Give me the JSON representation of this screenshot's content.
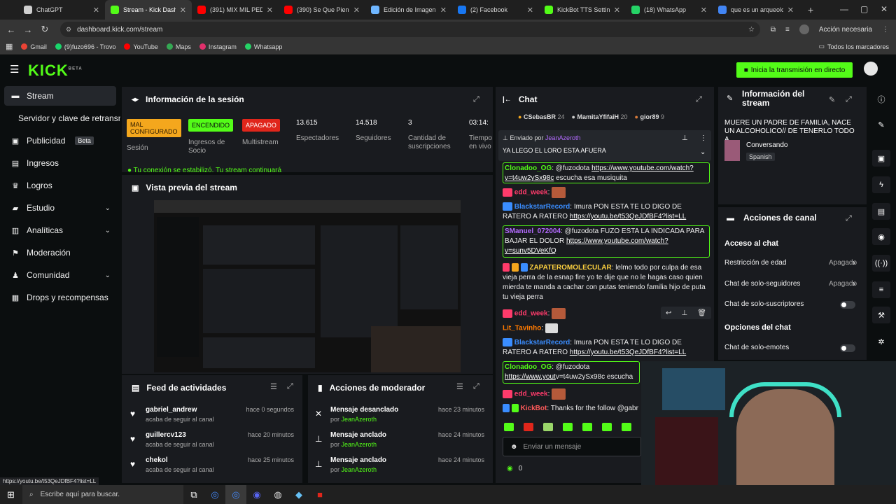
{
  "browser": {
    "tabs": [
      {
        "label": "ChatGPT",
        "color": "#cfcfcf"
      },
      {
        "label": "Stream - Kick Dashb",
        "color": "#53fc18"
      },
      {
        "label": "(391) MIX MIL PEDAZ",
        "color": "#ff0000"
      },
      {
        "label": "(390) Se Que Piensas",
        "color": "#ff0000"
      },
      {
        "label": "Edición de Imagen D",
        "color": "#6fb6ff"
      },
      {
        "label": "(2) Facebook",
        "color": "#1877f2"
      },
      {
        "label": "KickBot TTS Settings",
        "color": "#53fc18"
      },
      {
        "label": "(18) WhatsApp",
        "color": "#25d366"
      },
      {
        "label": "que es un arqueolog",
        "color": "#4285f4"
      }
    ],
    "url": "dashboard.kick.com/stream",
    "profile_label": "Acción necesaria",
    "bookmarks": [
      {
        "label": "Gmail",
        "color": "#ea4335"
      },
      {
        "label": "(9)fuzo696 - Trovo",
        "color": "#19d66b"
      },
      {
        "label": "YouTube",
        "color": "#ff0000"
      },
      {
        "label": "Maps",
        "color": "#34a853"
      },
      {
        "label": "Instagram",
        "color": "#e1306c"
      },
      {
        "label": "Whatsapp",
        "color": "#25d366"
      }
    ],
    "bookmarks_right": "Todos los marcadores"
  },
  "header": {
    "logo": "KICK",
    "logo_sup": "BETA",
    "go_live": "Inicia la transmisión en directo",
    "accent": "#53fc18"
  },
  "sidebar": {
    "items": [
      {
        "label": "Stream"
      },
      {
        "label": "Servidor y clave de retransmisión"
      },
      {
        "label": "Publicidad",
        "badge": "Beta"
      },
      {
        "label": "Ingresos"
      },
      {
        "label": "Logros"
      },
      {
        "label": "Estudio"
      },
      {
        "label": "Analíticas"
      },
      {
        "label": "Moderación"
      },
      {
        "label": "Comunidad"
      },
      {
        "label": "Drops y recompensas"
      }
    ]
  },
  "session": {
    "title": "Información de la sesión",
    "stats": [
      {
        "value": "MAL CONFIGURADO",
        "label": "Sesión"
      },
      {
        "value": "ENCENDIDO",
        "label": "Ingresos de Socio"
      },
      {
        "value": "APAGADO",
        "label": "Multistream"
      },
      {
        "value": "13.615",
        "label": "Espectadores"
      },
      {
        "value": "14.518",
        "label": "Seguidores"
      },
      {
        "value": "3",
        "label": "Cantidad de suscripciones"
      },
      {
        "value": "03:14:",
        "label": "Tiempo en vivo"
      }
    ],
    "notice": "Tu conexión se estabilizó. Tu stream continuará"
  },
  "preview": {
    "title": "Vista previa del stream"
  },
  "feed": {
    "title": "Feed de actividades",
    "items": [
      {
        "user": "gabriel_andrew",
        "sub": "acaba de seguir al canal",
        "time": "hace 0 segundos"
      },
      {
        "user": "guillercv123",
        "sub": "acaba de seguir al canal",
        "time": "hace 20 minutos"
      },
      {
        "user": "chekol",
        "sub": "acaba de seguir al canal",
        "time": "hace 25 minutos"
      }
    ]
  },
  "modactions": {
    "title": "Acciones de moderador",
    "items": [
      {
        "action": "Mensaje desanclado",
        "by_prefix": "por",
        "by": "JeanAzeroth",
        "time": "hace 23 minutos"
      },
      {
        "action": "Mensaje anclado",
        "by_prefix": "por",
        "by": "JeanAzeroth",
        "time": "hace 24 minutos"
      },
      {
        "action": "Mensaje anclado",
        "by_prefix": "por",
        "by": "JeanAzeroth",
        "time": "hace 24 minutos"
      }
    ]
  },
  "chat": {
    "title": "Chat",
    "top_gifters": [
      {
        "name": "CSebasBR",
        "count": "24"
      },
      {
        "name": "MamitaYfifaiH",
        "count": "20"
      },
      {
        "name": "gior89",
        "count": "9"
      }
    ],
    "pinned_by_prefix": "Enviado por",
    "pinned_by": "JeanAzeroth",
    "pinned_text": "YA LLEGO EL LORO ESTA AFUERA",
    "messages": [
      {
        "user": "Clonadoo_OG",
        "color": "#53fc18",
        "text": ": @fuzodota ",
        "link": "https://www.youtube.com/watch?v=t4uw2ySx98c",
        "after": " escucha esa musiquita"
      },
      {
        "user": "edd_week",
        "color": "#ff3b6b",
        "text": ":",
        "link": "",
        "after": ""
      },
      {
        "user": "BlackstarRecord",
        "color": "#3a8dff",
        "text": ": Imura PON ESTA TE LO DIGO DE RATERO A RATERO ",
        "link": "https://youtu.be/t53QeJDfBF4?list=LL",
        "after": ""
      },
      {
        "user": "SManuel_072004",
        "color": "#b36bff",
        "text": ": @fuzodota FUZO ESTA LA INDICADA PARA BAJAR EL DOLOR ",
        "link": "https://www.youtube.com/watch?v=sunv5DVeKfQ",
        "after": ""
      },
      {
        "user": "ZAPATEROMOLECULAR",
        "color": "#ffd23f",
        "text": ": lelmo todo por culpa de esa vieja perra de la esnap fire yo te dije que no le hagas caso quien mierda te manda a cachar con putas teniendo familia hijo de puta tu vieja perra",
        "link": "",
        "after": ""
      },
      {
        "user": "edd_week",
        "color": "#ff3b6b",
        "text": ":",
        "link": "",
        "after": ""
      },
      {
        "user": "Lit_Tavinho",
        "color": "#ff7a00",
        "text": ":",
        "link": "",
        "after": ""
      },
      {
        "user": "BlackstarRecord",
        "color": "#3a8dff",
        "text": ": Imura PON ESTA TE LO DIGO DE RATERO A RATERO ",
        "link": "https://youtu.be/t53QeJDfBF4?list=LL",
        "after": ""
      },
      {
        "user": "Clonadoo_OG",
        "color": "#53fc18",
        "text": ": @fuzodota ",
        "link": "https://www.yout",
        "after": "v=t4uw2ySx98c escucha esa musiquita"
      },
      {
        "user": "edd_week",
        "color": "#ff3b6b",
        "text": ":",
        "link": "",
        "after": ""
      },
      {
        "user": "KickBot",
        "color": "#ff5a5a",
        "text": ": Thanks for the follow @gabr",
        "link": "",
        "after": ""
      }
    ],
    "input_placeholder": "Enviar un mensaje",
    "points": "0"
  },
  "streaminfo": {
    "title": "Información del stream",
    "stream_title": "MUERE UN PADRE DE FAMILIA, NACE UN ALCOHOLICO// DE TENERLO TODO A...",
    "category": "Conversando",
    "language": "Spanish"
  },
  "channel": {
    "title": "Acciones de canal",
    "access_title": "Acceso al chat",
    "rows": [
      {
        "label": "Restricción de edad",
        "value": "Apagado"
      },
      {
        "label": "Chat de solo-seguidores",
        "value": "Apagado"
      },
      {
        "label": "Chat de solo-suscriptores",
        "value": ""
      }
    ],
    "options_title": "Opciones del chat",
    "options_rows": [
      {
        "label": "Chat de solo-emotes",
        "value": ""
      }
    ]
  },
  "statusbar": "https://youtu.be/t53QeJDfBF4?list=LL",
  "taskbar": {
    "search": "Escribe aquí para buscar."
  }
}
